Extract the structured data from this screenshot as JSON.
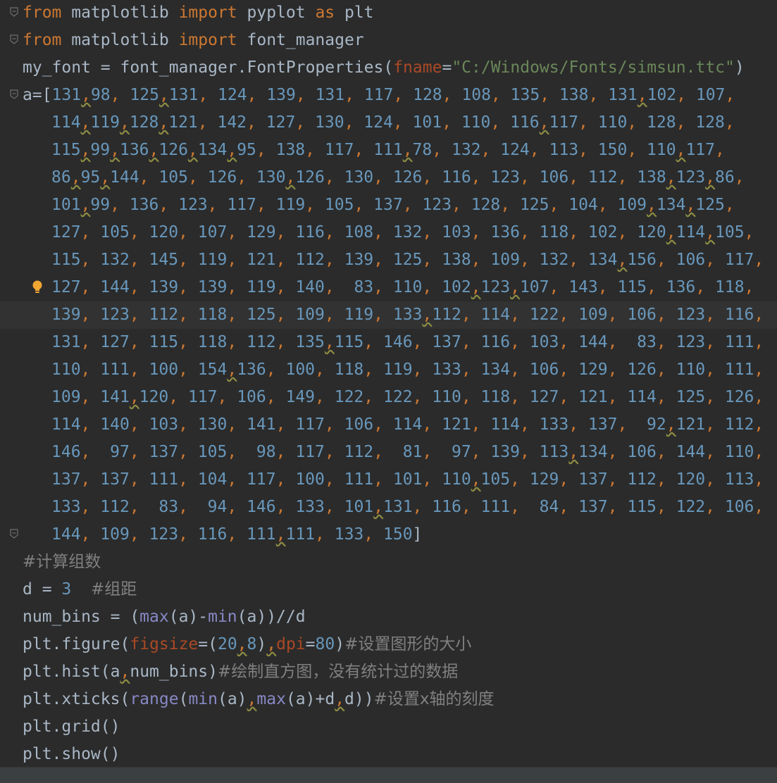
{
  "editor": {
    "lines": [
      {
        "text": "from matplotlib import pyplot as plt",
        "fold": true
      },
      {
        "text": "from matplotlib import font_manager",
        "fold": true
      },
      {
        "text": "my_font = font_manager.FontProperties(fname=\"C:/Windows/Fonts/simsun.ttc\")"
      },
      {
        "text": "a=[131,98, 125,131, 124, 139, 131, 117, 128, 108, 135, 138, 131,102, 107,",
        "fold": true
      },
      {
        "text": "114,119,128,121, 142, 127, 130, 124, 101, 110, 116,117, 110, 128, 128,",
        "indent": true
      },
      {
        "text": "115,99,136,126,134,95, 138, 117, 111,78, 132, 124, 113, 150, 110,117,",
        "indent": true
      },
      {
        "text": "86,95,144, 105, 126, 130,126, 130, 126, 116, 123, 106, 112, 138,123,86,",
        "indent": true
      },
      {
        "text": "101,99, 136, 123, 117, 119, 105, 137, 123, 128, 125, 104, 109,134,125,",
        "indent": true
      },
      {
        "text": "127, 105, 120, 107, 129, 116, 108, 132, 103, 136, 118, 102, 120,114,105,",
        "indent": true
      },
      {
        "text": "115, 132, 145, 119, 121, 112, 139, 125, 138, 109, 132, 134,156, 106, 117,",
        "indent": true
      },
      {
        "text": "127, 144, 139, 139, 119, 140,  83, 110, 102,123,107, 143, 115, 136, 118,",
        "indent": true,
        "bulb": true
      },
      {
        "text": "139, 123, 112, 118, 125, 109, 119, 133,112, 114, 122, 109, 106, 123, 116,",
        "indent": true,
        "current": true
      },
      {
        "text": "131, 127, 115, 118, 112, 135,115, 146, 137, 116, 103, 144,  83, 123, 111,",
        "indent": true
      },
      {
        "text": "110, 111, 100, 154,136, 100, 118, 119, 133, 134, 106, 129, 126, 110, 111,",
        "indent": true
      },
      {
        "text": "109, 141,120, 117, 106, 149, 122, 122, 110, 118, 127, 121, 114, 125, 126,",
        "indent": true
      },
      {
        "text": "114, 140, 103, 130, 141, 117, 106, 114, 121, 114, 133, 137,  92,121, 112,",
        "indent": true
      },
      {
        "text": "146,  97, 137, 105,  98, 117, 112,  81,  97, 139, 113,134, 106, 144, 110,",
        "indent": true
      },
      {
        "text": "137, 137, 111, 104, 117, 100, 111, 101, 110,105, 129, 137, 112, 120, 113,",
        "indent": true
      },
      {
        "text": "133, 112,  83,  94, 146, 133, 101,131, 116, 111,  84, 137, 115, 122, 106,",
        "indent": true
      },
      {
        "text": "144, 109, 123, 116, 111,111, 133, 150]",
        "indent": true,
        "fold": true
      },
      {
        "text": "#计算组数"
      },
      {
        "text": "d = 3  #组距"
      },
      {
        "text": "num_bins = (max(a)-min(a))//d"
      },
      {
        "text": "plt.figure(figsize=(20,8),dpi=80)#设置图形的大小"
      },
      {
        "text": "plt.hist(a,num_bins)#绘制直方图，没有统计过的数据"
      },
      {
        "text": "plt.xticks(range(min(a),max(a)+d,d))#设置x轴的刻度"
      },
      {
        "text": "plt.grid()"
      },
      {
        "text": "plt.show()"
      }
    ]
  },
  "colors": {
    "background": "#2b2b2b",
    "current_line": "#323232",
    "keyword": "#cc7832",
    "number": "#6897bb",
    "string": "#6a8759",
    "parameter": "#aa4926",
    "builtin": "#8888c6",
    "comment": "#808080",
    "identifier": "#a9b7c6"
  },
  "icons": {
    "fold_marker": "fold-marker-icon",
    "intention_bulb": "lightbulb-icon"
  }
}
